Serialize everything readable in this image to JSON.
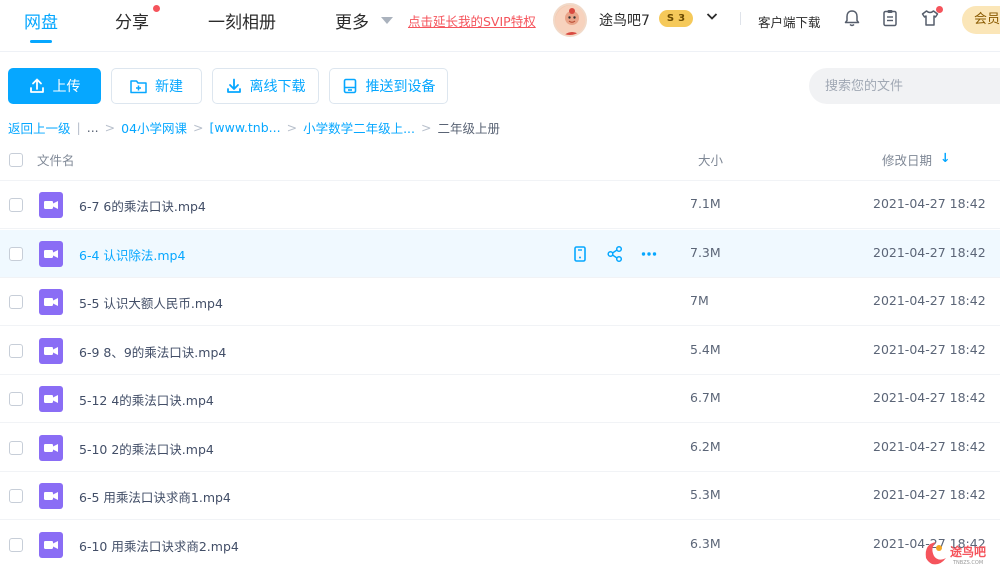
{
  "nav": {
    "items": [
      {
        "label": "网盘",
        "active": true
      },
      {
        "label": "分享",
        "dot": true
      },
      {
        "label": "一刻相册"
      },
      {
        "label": "更多"
      }
    ],
    "svip_link": "点击延长我的SVIP特权",
    "username": "途鸟吧7",
    "vip_level": "3",
    "client_download": "客户端下载",
    "member_button": "会员",
    "icons": [
      "bell-icon",
      "clipboard-icon",
      "shirt-icon"
    ]
  },
  "toolbar": {
    "upload": "上传",
    "new_folder": "新建",
    "offline_download": "离线下载",
    "push_to_device": "推送到设备",
    "search_placeholder": "搜索您的文件"
  },
  "breadcrumb": {
    "back": "返回上一级",
    "ellipsis": "...",
    "items": [
      "04小学网课",
      "[www.tnb...",
      "小学数学二年级上..."
    ],
    "current": "二年级上册"
  },
  "table": {
    "col_name": "文件名",
    "col_size": "大小",
    "col_date": "修改日期",
    "sort_indicator": "↓",
    "hover_row_index": 1,
    "rows": [
      {
        "name": "6-7 6的乘法口诀.mp4",
        "size": "7.1M",
        "date": "2021-04-27 18:42"
      },
      {
        "name": "6-4 认识除法.mp4",
        "size": "7.3M",
        "date": "2021-04-27 18:42"
      },
      {
        "name": "5-5 认识大额人民币.mp4",
        "size": "7M",
        "date": "2021-04-27 18:42"
      },
      {
        "name": "6-9 8、9的乘法口诀.mp4",
        "size": "5.4M",
        "date": "2021-04-27 18:42"
      },
      {
        "name": "5-12 4的乘法口诀.mp4",
        "size": "6.7M",
        "date": "2021-04-27 18:42"
      },
      {
        "name": "5-10 2的乘法口诀.mp4",
        "size": "6.2M",
        "date": "2021-04-27 18:42"
      },
      {
        "name": "6-5 用乘法口诀求商1.mp4",
        "size": "5.3M",
        "date": "2021-04-27 18:42"
      },
      {
        "name": "6-10 用乘法口诀求商2.mp4",
        "size": "6.3M",
        "date": "2021-04-27 18:42"
      }
    ]
  },
  "watermark": {
    "text": "途鸟吧",
    "subtext": "TNBZS.COM"
  },
  "colors": {
    "accent": "#06a7ff",
    "video_icon": "#8a6df5",
    "svip": "#f5545c",
    "hover_row": "#f0f9ff"
  }
}
